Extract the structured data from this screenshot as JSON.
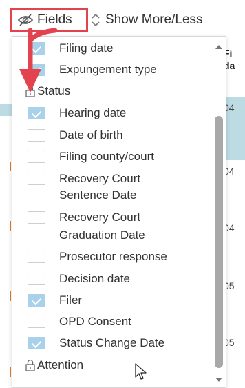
{
  "toolbar": {
    "fields_label": "Fields",
    "show_more_label": "Show More/Less"
  },
  "fields_menu": {
    "items": [
      {
        "label": "Filing date",
        "checked": true
      },
      {
        "label": "Expungement type",
        "checked": true
      },
      {
        "group": "Status"
      },
      {
        "label": "Hearing date",
        "checked": true
      },
      {
        "label": "Date of birth",
        "checked": false
      },
      {
        "label": "Filing county/court",
        "checked": false
      },
      {
        "label": "Recovery Court Sentence Date",
        "line1": "Recovery Court",
        "line2": "Sentence Date",
        "checked": false
      },
      {
        "label": "Recovery Court Graduation Date",
        "line1": "Recovery Court",
        "line2": "Graduation Date",
        "checked": false
      },
      {
        "label": "Prosecutor response",
        "checked": false
      },
      {
        "label": "Decision date",
        "checked": false
      },
      {
        "label": "Filer",
        "checked": true
      },
      {
        "label": "OPD Consent",
        "checked": false
      },
      {
        "label": "Status Change Date",
        "checked": true
      },
      {
        "group": "Attention"
      }
    ]
  },
  "background_table": {
    "header_line1": "Fi",
    "header_line2": "da",
    "rows": [
      "04",
      "04",
      "04",
      "05",
      "05"
    ]
  },
  "colors": {
    "highlight_border": "#e2434e",
    "checkbox_checked": "#a9d2ea",
    "row_highlight": "#bcdbe2",
    "scrollbar_thumb": "#a8a8a8"
  }
}
